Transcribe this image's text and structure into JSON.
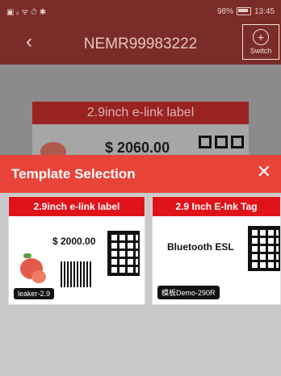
{
  "status": {
    "left_icons": "▣ ᵢₗ ᯤ ⏱ ✱",
    "battery_percent": "98%",
    "time": "13:45"
  },
  "header": {
    "title": "NEMR99983222",
    "switch_label": "Switch"
  },
  "background_card": {
    "header": "2.9inch e-link label",
    "price": "$ 2060.00"
  },
  "modal": {
    "title": "Template Selection",
    "templates": [
      {
        "header": "2.9inch e-link label",
        "price": "$ 2000.00",
        "name": "leaker-2.9"
      },
      {
        "header": "2.9 Inch E-Ink Tag",
        "text": "Bluetooth ESL",
        "name": "模板Demo-290R"
      }
    ]
  }
}
